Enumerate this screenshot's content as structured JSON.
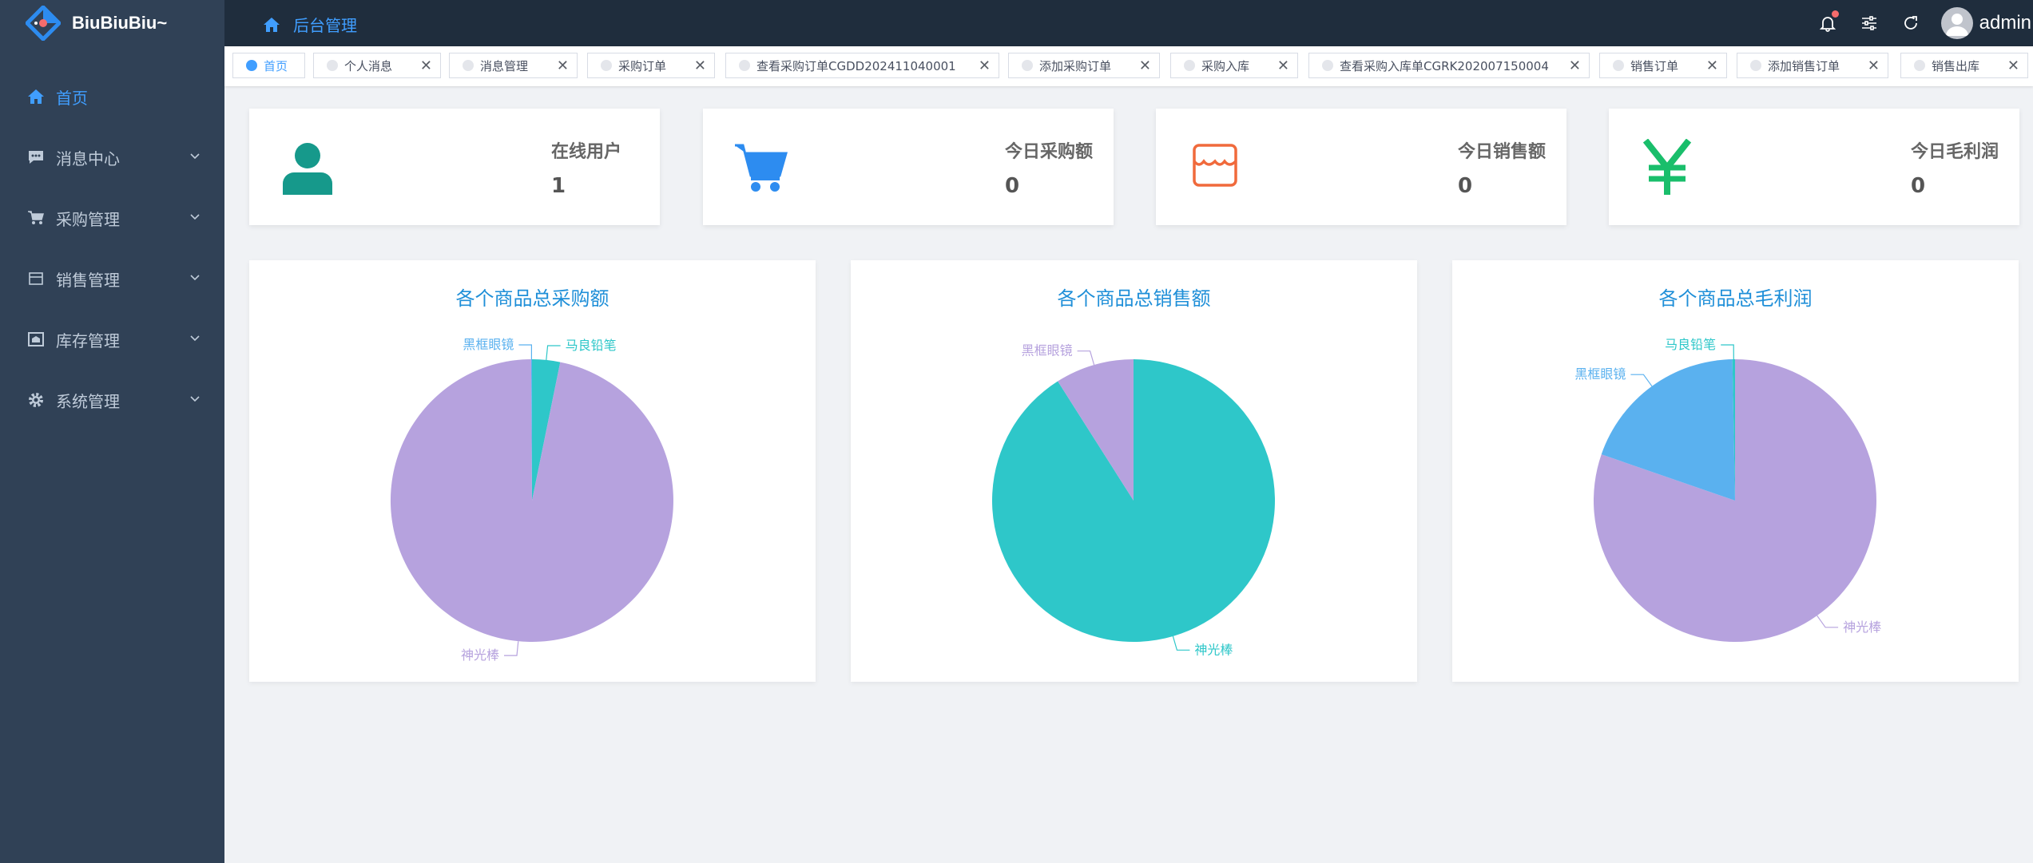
{
  "app": {
    "name": "BiuBiuBiu~"
  },
  "sidebar": {
    "items": [
      {
        "label": "首页",
        "icon": "home-icon",
        "active": true
      },
      {
        "label": "消息中心",
        "icon": "message-icon"
      },
      {
        "label": "采购管理",
        "icon": "cart-icon"
      },
      {
        "label": "销售管理",
        "icon": "sales-icon"
      },
      {
        "label": "库存管理",
        "icon": "warehouse-icon"
      },
      {
        "label": "系统管理",
        "icon": "gear-icon"
      }
    ]
  },
  "header": {
    "breadcrumb": "后台管理",
    "user": "admin"
  },
  "tags": [
    {
      "label": "首页",
      "active": true,
      "close": false
    },
    {
      "label": "个人消息",
      "close": true
    },
    {
      "label": "消息管理",
      "close": true
    },
    {
      "label": "采购订单",
      "close": true
    },
    {
      "label": "查看采购订单CGDD202411040001",
      "close": true
    },
    {
      "label": "添加采购订单",
      "close": true
    },
    {
      "label": "采购入库",
      "close": true
    },
    {
      "label": "查看采购入库单CGRK202007150004",
      "close": true
    },
    {
      "label": "销售订单",
      "close": true
    },
    {
      "label": "添加销售订单",
      "close": true
    },
    {
      "label": "销售出库",
      "close": true
    }
  ],
  "stats": [
    {
      "label": "在线用户",
      "value": "1",
      "icon": "user-icon",
      "color": "#16998b"
    },
    {
      "label": "今日采购额",
      "value": "0",
      "icon": "cart-icon",
      "color": "#2d8cf0"
    },
    {
      "label": "今日销售额",
      "value": "0",
      "icon": "shop-icon",
      "color": "#f06a3c"
    },
    {
      "label": "今日毛利润",
      "value": "0",
      "icon": "yen-icon",
      "color": "#19be6b"
    }
  ],
  "colors": {
    "purple": "#b6a2de",
    "teal": "#2ec7c9",
    "blue": "#5ab1ef",
    "sidebar": "#304156",
    "accent": "#409eff"
  },
  "chart_data": [
    {
      "type": "pie",
      "title": "各个商品总采购额",
      "slices": [
        {
          "name": "马良铅笔",
          "value": 3.2,
          "color": "#2ec7c9"
        },
        {
          "name": "神光棒",
          "value": 96.7,
          "color": "#b6a2de"
        },
        {
          "name": "黑框眼镜",
          "value": 0.1,
          "color": "#5ab1ef"
        }
      ]
    },
    {
      "type": "pie",
      "title": "各个商品总销售额",
      "slices": [
        {
          "name": "神光棒",
          "value": 91,
          "color": "#2ec7c9"
        },
        {
          "name": "黑框眼镜",
          "value": 9,
          "color": "#b6a2de"
        }
      ]
    },
    {
      "type": "pie",
      "title": "各个商品总毛利润",
      "slices": [
        {
          "name": "神光棒",
          "value": 80.3,
          "color": "#b6a2de"
        },
        {
          "name": "黑框眼镜",
          "value": 19.4,
          "color": "#5ab1ef"
        },
        {
          "name": "马良铅笔",
          "value": 0.3,
          "color": "#2ec7c9"
        }
      ]
    }
  ]
}
